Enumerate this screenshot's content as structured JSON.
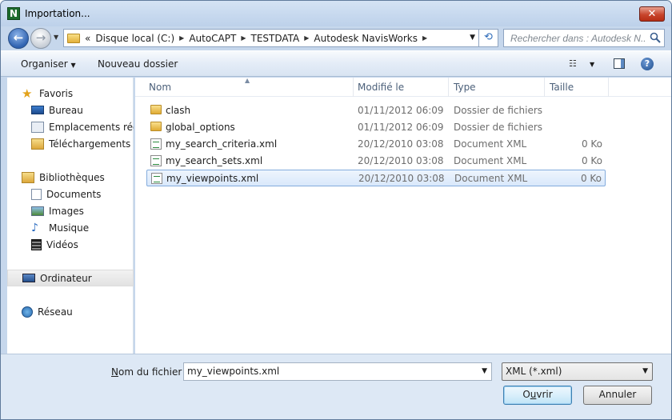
{
  "window": {
    "title": "Importation...",
    "app_icon_letter": "N",
    "close_glyph": "✕"
  },
  "navigation": {
    "back_glyph": "←",
    "forward_glyph": "→",
    "address_prefix": "«",
    "breadcrumb": [
      "Disque local (C:)",
      "AutoCAPT",
      "TESTDATA",
      "Autodesk NavisWorks"
    ],
    "refresh_glyph": "⟲",
    "search_placeholder": "Rechercher dans : Autodesk N..."
  },
  "toolbar": {
    "organize_label": "Organiser",
    "new_folder_label": "Nouveau dossier",
    "help_glyph": "?"
  },
  "sidebar": {
    "favorites": {
      "label": "Favoris",
      "items": [
        "Bureau",
        "Emplacements récents",
        "Téléchargements"
      ]
    },
    "libraries": {
      "label": "Bibliothèques",
      "items": [
        "Documents",
        "Images",
        "Musique",
        "Vidéos"
      ]
    },
    "computer": {
      "label": "Ordinateur"
    },
    "network": {
      "label": "Réseau"
    }
  },
  "file_list": {
    "columns": {
      "name": "Nom",
      "modified": "Modifié le",
      "type": "Type",
      "size": "Taille"
    },
    "rows": [
      {
        "name": "clash",
        "modified": "01/11/2012 06:09",
        "type": "Dossier de fichiers",
        "size": "",
        "kind": "folder"
      },
      {
        "name": "global_options",
        "modified": "01/11/2012 06:09",
        "type": "Dossier de fichiers",
        "size": "",
        "kind": "folder"
      },
      {
        "name": "my_search_criteria.xml",
        "modified": "20/12/2010 03:08",
        "type": "Document XML",
        "size": "0 Ko",
        "kind": "xml"
      },
      {
        "name": "my_search_sets.xml",
        "modified": "20/12/2010 03:08",
        "type": "Document XML",
        "size": "0 Ko",
        "kind": "xml"
      },
      {
        "name": "my_viewpoints.xml",
        "modified": "20/12/2010 03:08",
        "type": "Document XML",
        "size": "0 Ko",
        "kind": "xml",
        "selected": true
      }
    ]
  },
  "footer": {
    "filename_label_mnemonic": "N",
    "filename_label_rest": "om du fichier :",
    "filename_value": "my_viewpoints.xml",
    "filter_value": "XML (*.xml)",
    "open_label_pre": "O",
    "open_label_mnemonic": "u",
    "open_label_post": "vrir",
    "cancel_label": "Annuler"
  }
}
